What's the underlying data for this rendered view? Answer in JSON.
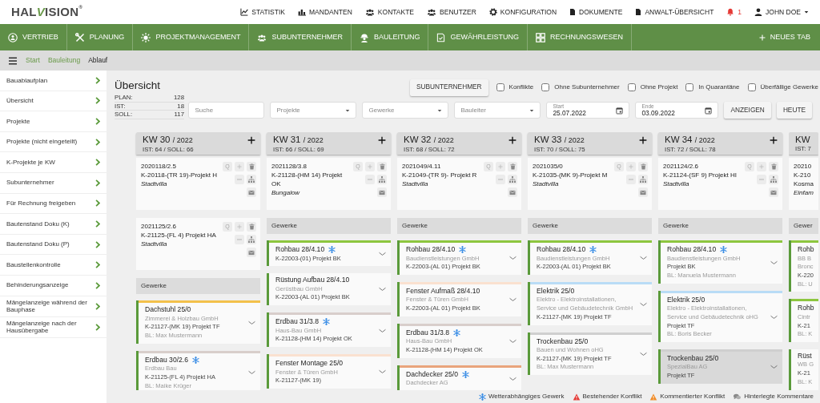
{
  "logo": {
    "start": "HAL",
    "accent": "V",
    "end": "ISION",
    "mark": "®"
  },
  "top_nav": [
    {
      "kind": "link",
      "label": "STATISTIK"
    },
    {
      "kind": "link",
      "label": "MANDANTEN"
    },
    {
      "kind": "link",
      "label": "KONTAKTE"
    },
    {
      "kind": "link",
      "label": "BENUTZER"
    },
    {
      "kind": "link",
      "label": "KONFIGURATION"
    },
    {
      "kind": "link",
      "label": "DOKUMENTE"
    },
    {
      "kind": "link",
      "label": "ANWALT-ÜBERSICHT"
    },
    {
      "kind": "bell",
      "label": "1"
    },
    {
      "kind": "user",
      "label": "JOHN DOE"
    }
  ],
  "main_nav": {
    "items": [
      "VERTRIEB",
      "PLANUNG",
      "PROJEKTMANAGEMENT",
      "SUBUNTERNEHMER",
      "BAULEITUNG",
      "GEWÄHRLEISTUNG",
      "RECHNUNGSWESEN"
    ],
    "new_tab": "NEUES TAB"
  },
  "breadcrumb": [
    {
      "label": "Start",
      "current": false
    },
    {
      "label": "Bauleitung",
      "current": false
    },
    {
      "label": "Ablauf",
      "current": true
    }
  ],
  "sidebar": {
    "items": [
      "Bauablaufplan",
      "Übersicht",
      "Projekte",
      "Projekte (nicht eingeteilt)",
      "K-Projekte je KW",
      "Subunternehmer",
      "Für Rechnung freigeben",
      "Bautenstand Doku (K)",
      "Bautenstand Doku (P)",
      "Baustellenkontrolle",
      "Behinderungsanzeige",
      "Mängelanzeige während der Bauphase",
      "Mängelanzeige nach der Hausübergabe"
    ]
  },
  "overview": {
    "title": "Übersicht",
    "stats": [
      {
        "label": "PLAN:",
        "value": "128"
      },
      {
        "label": "IST:",
        "value": "18"
      },
      {
        "label": "SOLL:",
        "value": "117"
      }
    ]
  },
  "filters": {
    "subcontractor_button": "SUBUNTERNEHMER",
    "checkboxes": [
      {
        "label": "Konflikte",
        "checked": false
      },
      {
        "label": "Ohne Subunternehmer",
        "checked": false
      },
      {
        "label": "Ohne Projekt",
        "checked": false
      },
      {
        "label": "In Quarantäne",
        "checked": false
      },
      {
        "label": "Überfällige Gewerke",
        "checked": false
      }
    ],
    "search": {
      "placeholder": "Suche"
    },
    "selects": [
      {
        "placeholder": "Projekte"
      },
      {
        "placeholder": "Gewerke"
      },
      {
        "placeholder": "Bauleiter"
      }
    ],
    "dates": [
      {
        "label": "Start",
        "value": "25.07.2022"
      },
      {
        "label": "Ende",
        "value": "03.09.2022"
      }
    ],
    "buttons": [
      "ANZEIGEN",
      "HEUTE"
    ]
  },
  "weeks": [
    {
      "title": "KW 30",
      "year": "/ 2022",
      "counts": "IST: 64 / SOLL: 66",
      "partial": false,
      "projects": [
        {
          "number": "2020118/2.5",
          "name": "K-20118-(TR 19)-Projekt H",
          "type": "Stadtvilla",
          "quick": "Q"
        },
        {
          "number": "2021125/2.6",
          "name": "K-21125-(FL 4) Projekt HA",
          "type": "Stadtvilla",
          "quick": "Q"
        }
      ],
      "trades_label": "Gewerke",
      "trades": [
        {
          "title": "Dachstuhl 25/0",
          "weather": false,
          "highlighted": false,
          "color": "#f3c14b",
          "details": [
            {
              "kind": "muted",
              "text": "Zimmerei & Holzbau GmbH"
            },
            {
              "kind": "strong",
              "text": "K-21127-(MK 19) Projekt TF"
            },
            {
              "kind": "muted",
              "text": "BL: Max Mustermann"
            }
          ]
        },
        {
          "title": "Erdbau 30/2.6",
          "weather": true,
          "highlighted": false,
          "color": "#d8cecb",
          "details": [
            {
              "kind": "muted",
              "text": "Erdbau Bau"
            },
            {
              "kind": "strong",
              "text": "K-21125-(FL 4) Projekt HA"
            },
            {
              "kind": "muted",
              "text": "BL: Maike Krüger"
            }
          ]
        }
      ]
    },
    {
      "title": "KW 31",
      "year": "/ 2022",
      "counts": "IST: 66 / SOLL: 69",
      "partial": false,
      "projects": [
        {
          "number": "2021128/3.8",
          "name": "K-21128-(HM 14) Projekt OK",
          "type": "Bungalow",
          "quick": "Q"
        }
      ],
      "trades_label": "Gewerke",
      "trades": [
        {
          "title": "Rohbau 28/4.10",
          "weather": true,
          "highlighted": false,
          "color": "#8dc63f",
          "details": [
            {
              "kind": "strong",
              "text": "K-22003-(01) Projekt BK"
            }
          ]
        },
        {
          "title": "Rüstung Aufbau 28/4.10",
          "weather": false,
          "highlighted": false,
          "details": [
            {
              "kind": "muted",
              "text": "Gerüstbau GmbH"
            },
            {
              "kind": "strong",
              "text": "K-22003-(AL 01) Projekt BK"
            }
          ]
        },
        {
          "title": "Erdbau 31/3.8",
          "weather": true,
          "highlighted": false,
          "color": "#d8cecb",
          "details": [
            {
              "kind": "muted",
              "text": "Haus-Bau GmbH"
            },
            {
              "kind": "strong",
              "text": "K-21128-(HM 14) Projekt OK"
            }
          ]
        },
        {
          "title": "Fenster Montage 25/0",
          "weather": false,
          "highlighted": false,
          "color": "#fae1d0",
          "details": [
            {
              "kind": "muted",
              "text": "Fenster & Türen GmbH"
            },
            {
              "kind": "strong",
              "text": "K-21127-(MK 19)"
            }
          ]
        }
      ]
    },
    {
      "title": "KW 32",
      "year": "/ 2022",
      "counts": "IST: 68 / SOLL: 72",
      "partial": false,
      "projects": [
        {
          "number": "2021049/4.11",
          "name": "K-21049-(TR 9)- Projekt R",
          "type": "Stadtvilla",
          "quick": "Q"
        }
      ],
      "trades_label": "Gewerke",
      "trades": [
        {
          "title": "Rohbau 28/4.10",
          "weather": true,
          "highlighted": false,
          "color": "#8dc63f",
          "details": [
            {
              "kind": "muted",
              "text": "Baudienstleistungen GmbH"
            },
            {
              "kind": "strong",
              "text": "K-22003-(AL 01) Projekt BK"
            }
          ]
        },
        {
          "title": "Fenster Aufmaß 28/4.10",
          "weather": false,
          "highlighted": false,
          "color": "#fae1d0",
          "details": [
            {
              "kind": "muted",
              "text": "Fenster & Türen GmbH"
            },
            {
              "kind": "strong",
              "text": "K-22003-(AL 01) Projekt BK"
            }
          ]
        },
        {
          "title": "Erdbau 31/3.8",
          "weather": true,
          "highlighted": false,
          "color": "#d8cecb",
          "details": [
            {
              "kind": "muted",
              "text": "Haus-Bau GmbH"
            },
            {
              "kind": "strong",
              "text": "K-21128-(HM 14) Projekt OK"
            }
          ]
        },
        {
          "title": "Dachdecker 25/0",
          "weather": true,
          "highlighted": false,
          "color": "#e9a47c",
          "details": [
            {
              "kind": "muted",
              "text": "Dachdecker AG"
            }
          ]
        }
      ]
    },
    {
      "title": "KW 33",
      "year": "/ 2022",
      "counts": "IST: 70 / SOLL: 75",
      "partial": false,
      "projects": [
        {
          "number": "2021035/0",
          "name": "K-21035-(MK 9)-Projekt M",
          "type": "Stadtvilla",
          "quick": "Q"
        }
      ],
      "trades_label": "Gewerke",
      "trades": [
        {
          "title": "Rohbau 28/4.10",
          "weather": true,
          "highlighted": false,
          "color": "#8dc63f",
          "details": [
            {
              "kind": "muted",
              "text": "Baudienstleistungen GmbH"
            },
            {
              "kind": "strong",
              "text": "K-22003-(AL 01) Projekt BK"
            }
          ]
        },
        {
          "title": "Elektrik 25/0",
          "weather": false,
          "highlighted": false,
          "color": "#b9dcf6",
          "details": [
            {
              "kind": "muted",
              "text": "Elektro - Elektroinstallationen, Service und Gebäudetechnik GmbH"
            },
            {
              "kind": "strong",
              "text": "K-21127-(MK 19) Projekt TF"
            }
          ]
        },
        {
          "title": "Trockenbau 25/0",
          "weather": false,
          "highlighted": false,
          "color": "#cfcfcf",
          "details": [
            {
              "kind": "muted",
              "text": "Bauen und Wohnen oHG"
            },
            {
              "kind": "strong",
              "text": "K-21127-(MK 19) Projekt TF"
            },
            {
              "kind": "muted",
              "text": "BL: Max Mustermann"
            }
          ]
        }
      ]
    },
    {
      "title": "KW 34",
      "year": "/ 2022",
      "counts": "IST: 72 / SOLL: 78",
      "partial": false,
      "projects": [
        {
          "number": "2021124/2.6",
          "name": "K-21124-(SF 9) Projekt HI",
          "type": "Stadtvilla",
          "quick": "Q"
        }
      ],
      "trades_label": "Gewerke",
      "trades": [
        {
          "title": "Rohbau 28/4.10",
          "weather": true,
          "highlighted": false,
          "color": "#8dc63f",
          "details": [
            {
              "kind": "muted",
              "text": "Baudienstleistungen GmbH"
            },
            {
              "kind": "strong",
              "text": "Projekt BK"
            },
            {
              "kind": "muted",
              "text": "BL: Manuela Mustermann"
            }
          ]
        },
        {
          "title": "Elektrik 25/0",
          "weather": false,
          "highlighted": false,
          "color": "#b9dcf6",
          "details": [
            {
              "kind": "muted",
              "text": "Elektro - Elektroinstallationen, Service und Gebäudetechnik oHG"
            },
            {
              "kind": "strong",
              "text": "Projekt TF"
            },
            {
              "kind": "muted",
              "text": "BL: Boris Becker"
            }
          ]
        },
        {
          "title": "Trockenbau 25/0",
          "weather": false,
          "highlighted": true,
          "color": "#cfcfcf",
          "details": [
            {
              "kind": "muted",
              "text": "SpezialBau AG"
            },
            {
              "kind": "strong",
              "text": "Projekt TF"
            }
          ]
        }
      ]
    },
    {
      "title": "KW",
      "counts": "IST: 7",
      "partial": true,
      "projects": [
        {
          "number": "20210",
          "name": "K-210 Kosma",
          "type": "Einfam"
        }
      ],
      "trades_label": "Gewer",
      "trades": [
        {
          "title": "Rohb",
          "weather": false,
          "highlighted": false,
          "color": "#8dc63f",
          "details": [
            {
              "kind": "muted",
              "text": "BB B"
            },
            {
              "kind": "muted",
              "text": "Bronc"
            },
            {
              "kind": "strong",
              "text": "K-220"
            },
            {
              "kind": "muted",
              "text": "BL: U"
            }
          ]
        },
        {
          "title": "Rohb",
          "weather": false,
          "highlighted": false,
          "color": "#8dc63f",
          "details": [
            {
              "kind": "muted",
              "text": "Cintr"
            },
            {
              "kind": "strong",
              "text": "K-21"
            },
            {
              "kind": "muted",
              "text": "BL: K"
            }
          ]
        },
        {
          "title": "Rüst",
          "weather": false,
          "highlighted": false,
          "details": [
            {
              "kind": "muted",
              "text": "WB G"
            },
            {
              "kind": "strong",
              "text": "K-21"
            },
            {
              "kind": "muted",
              "text": "BL: K"
            }
          ]
        }
      ]
    }
  ],
  "legend": [
    {
      "kind": "weather",
      "label": "Wetterabhängiges Gewerk"
    },
    {
      "kind": "conflict",
      "label": "Bestehender Konflikt"
    },
    {
      "kind": "commented",
      "label": "Kommentierter Konflikt"
    },
    {
      "kind": "comments",
      "label": "Hinterlegte Kommentare"
    }
  ]
}
